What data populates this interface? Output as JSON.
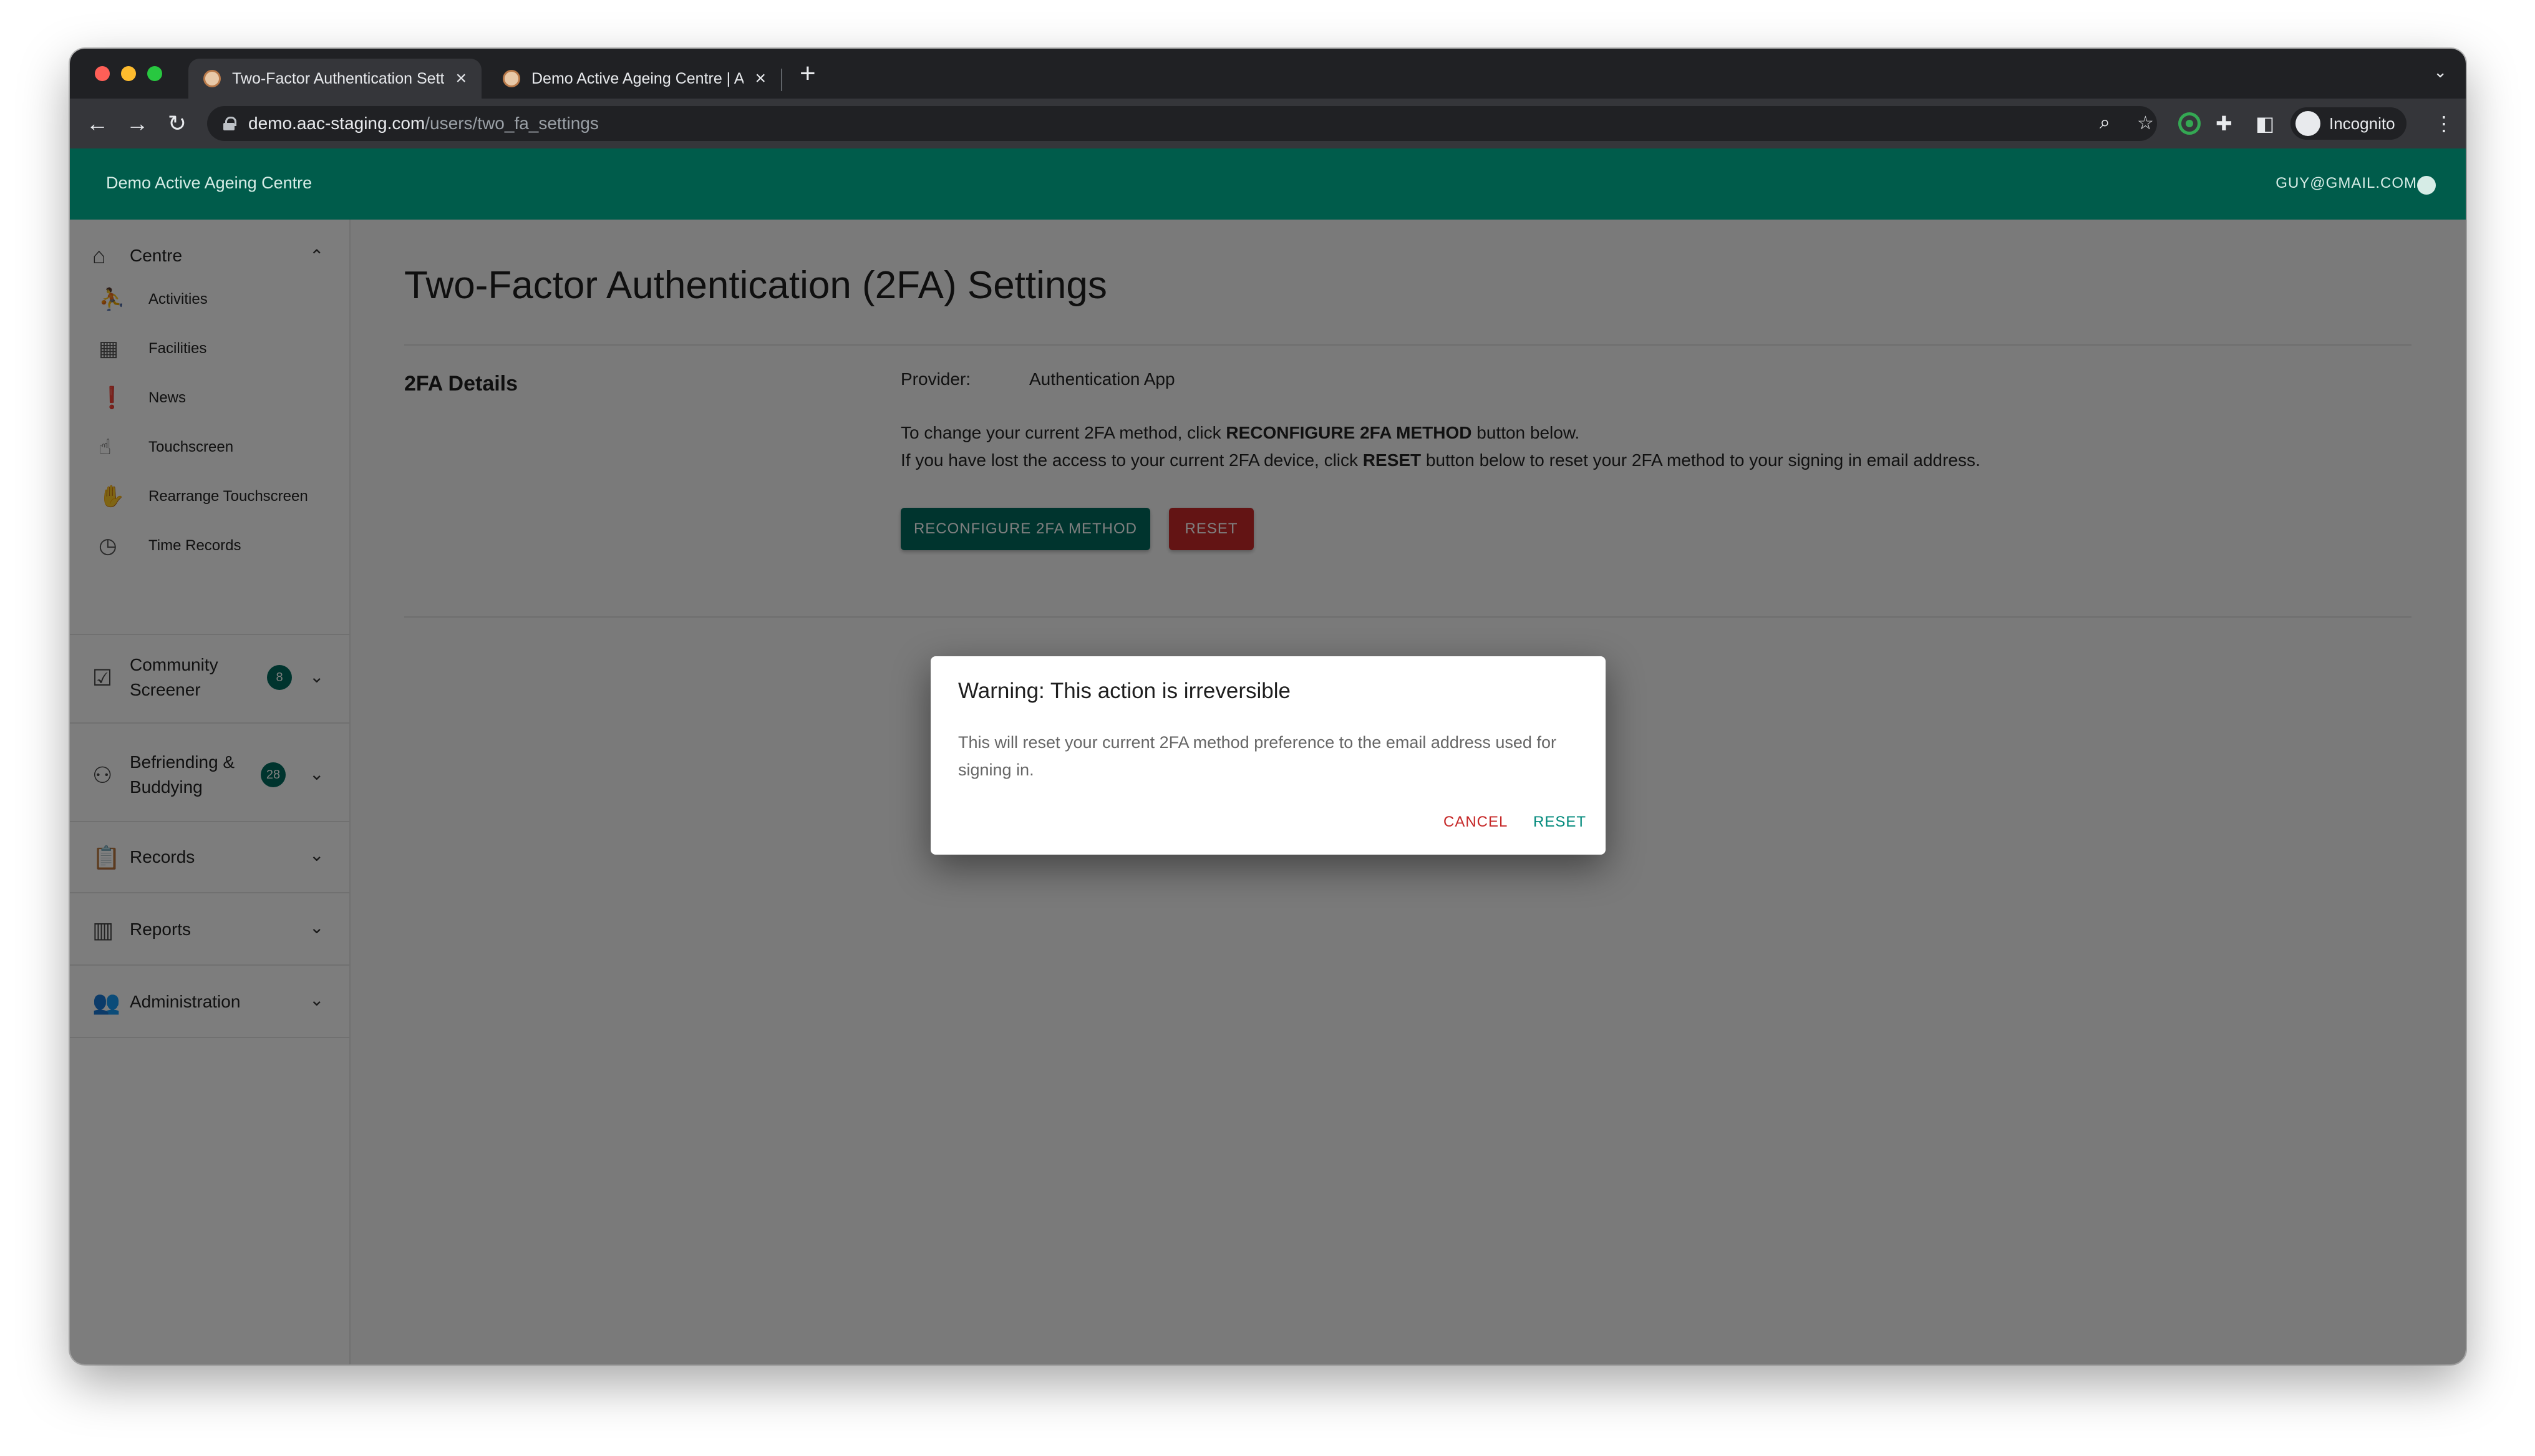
{
  "browser": {
    "tabs": [
      {
        "title": "Two-Factor Authentication Settings",
        "active": true
      },
      {
        "title": "Demo Active Ageing Centre | Activities",
        "active": false
      }
    ],
    "url_host": "demo.aac-staging.com",
    "url_path": "/users/two_fa_settings",
    "profile_label": "Incognito"
  },
  "app": {
    "brand": "Demo Active Ageing Centre",
    "user_email": "GUY@GMAIL.COM",
    "accent_color": "#005c4b"
  },
  "sidebar": {
    "centre": {
      "label": "Centre",
      "items": [
        {
          "label": "Activities",
          "icon": "run-icon"
        },
        {
          "label": "Facilities",
          "icon": "building-icon"
        },
        {
          "label": "News",
          "icon": "announcement-icon"
        },
        {
          "label": "Touchscreen",
          "icon": "touch-icon"
        },
        {
          "label": "Rearrange Touchscreen",
          "icon": "hand-icon"
        },
        {
          "label": "Time Records",
          "icon": "clock-icon"
        }
      ]
    },
    "community": {
      "label_line1": "Community",
      "label_line2": "Screener",
      "badge": "8"
    },
    "befriending": {
      "label_line1": "Befriending &",
      "label_line2": "Buddying",
      "badge": "28"
    },
    "records": {
      "label": "Records"
    },
    "reports": {
      "label": "Reports"
    },
    "administration": {
      "label": "Administration"
    }
  },
  "page": {
    "title": "Two-Factor Authentication (2FA) Settings",
    "section_title": "2FA Details",
    "provider_label": "Provider:",
    "provider_value": "Authentication App",
    "line1_pre": "To change your current 2FA method, click ",
    "line1_bold": "RECONFIGURE 2FA METHOD",
    "line1_post": " button below.",
    "line2_pre": "If you have lost the access to your current 2FA device, click ",
    "line2_bold": "RESET",
    "line2_post": " button below to reset your 2FA method to your signing in email address.",
    "reconfigure_label": "RECONFIGURE 2FA METHOD",
    "reset_label": "RESET"
  },
  "dialog": {
    "title": "Warning: This action is irreversible",
    "body": "This will reset your current 2FA method preference to the email address used for signing in.",
    "cancel_label": "CANCEL",
    "confirm_label": "RESET"
  }
}
